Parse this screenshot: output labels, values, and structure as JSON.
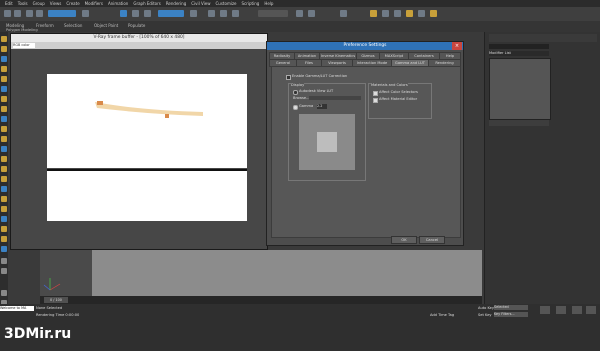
{
  "menu": [
    "Edit",
    "Tools",
    "Group",
    "Views",
    "Create",
    "Modifiers",
    "Animation",
    "Graph Editors",
    "Rendering",
    "Civil View",
    "Customize",
    "Scripting",
    "Help"
  ],
  "ribbon": {
    "tabs": [
      "Modeling",
      "Freeform",
      "Selection",
      "Object Paint",
      "Populate"
    ],
    "sub": "Polygon Modeling"
  },
  "frame_buffer": {
    "title": "V-Ray frame buffer - [100% of 640 x 480]",
    "channel": "RGB color"
  },
  "dialog": {
    "title": "Preference Settings",
    "close": "×",
    "tabs_row1": [
      "Radiosity",
      "Animation",
      "Inverse Kinematics",
      "Gizmos",
      "MAXScript",
      "Containers",
      "Help"
    ],
    "tabs_row2": [
      "General",
      "Files",
      "Viewports",
      "Interaction Mode",
      "Gamma and LUT",
      "Rendering"
    ],
    "enable": "Enable Gamma/LUT Correction",
    "display": {
      "label": "Display",
      "autodesk": "Autodesk View LUT",
      "browse": "Browse...",
      "gamma": "Gamma",
      "gamma_value": "2.2"
    },
    "materials": {
      "label": "Materials and Colors",
      "affect_color": "Affect Color Selectors",
      "affect_material": "Affect Material Editor"
    },
    "ok": "OK",
    "cancel": "Cancel"
  },
  "command_panel": {
    "label": "Modifier List"
  },
  "status": {
    "script": "Welcome to MA",
    "none": "None Selected",
    "render_time": "Rendering Time 0:00:00",
    "add_tag": "Add Time Tag",
    "auto_key": "Auto Key",
    "selected": "Selected",
    "set_key": "Set Key",
    "key_filters": "Key Filters...",
    "frame": "0 / 100"
  },
  "watermark": "3DMir.ru"
}
